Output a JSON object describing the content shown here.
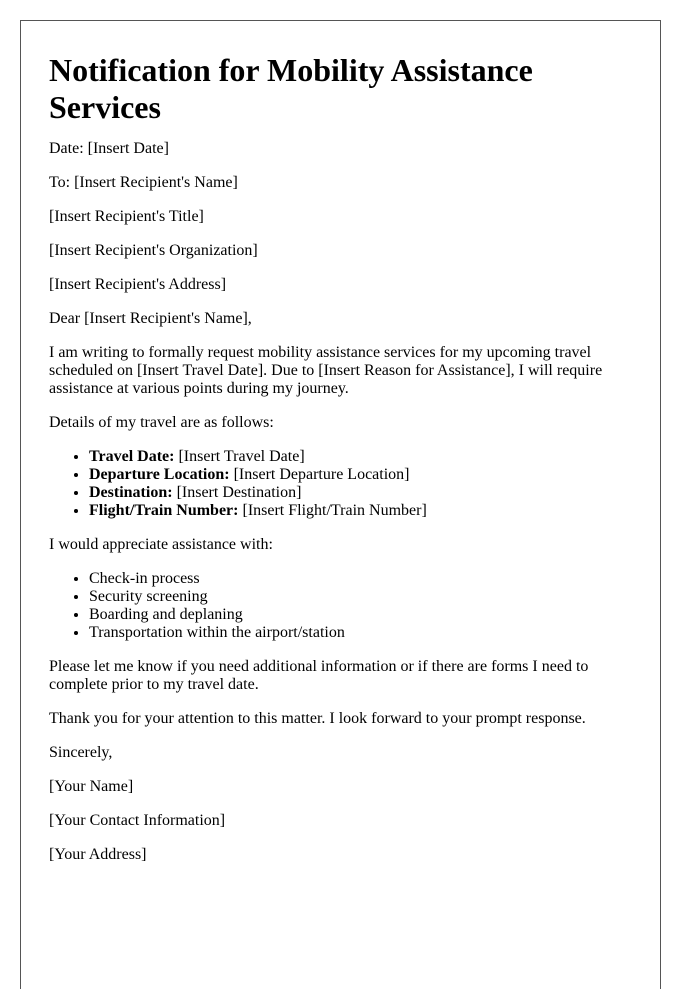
{
  "letter": {
    "title": "Notification for Mobility Assistance Services",
    "date_line": "Date: [Insert Date]",
    "to_line": "To: [Insert Recipient's Name]",
    "recipient_title": "[Insert Recipient's Title]",
    "recipient_org": "[Insert Recipient's Organization]",
    "recipient_address": "[Insert Recipient's Address]",
    "salutation": "Dear [Insert Recipient's Name],",
    "intro": "I am writing to formally request mobility assistance services for my upcoming travel scheduled on [Insert Travel Date]. Due to [Insert Reason for Assistance], I will require assistance at various points during my journey.",
    "details_heading": "Details of my travel are as follows:",
    "details": [
      {
        "label": "Travel Date:",
        "value": " [Insert Travel Date]"
      },
      {
        "label": "Departure Location:",
        "value": " [Insert Departure Location]"
      },
      {
        "label": "Destination:",
        "value": " [Insert Destination]"
      },
      {
        "label": "Flight/Train Number:",
        "value": " [Insert Flight/Train Number]"
      }
    ],
    "assistance_heading": "I would appreciate assistance with:",
    "assistance_items": [
      "Check-in process",
      "Security screening",
      "Boarding and deplaning",
      "Transportation within the airport/station"
    ],
    "followup": "Please let me know if you need additional information or if there are forms I need to complete prior to my travel date.",
    "thanks": "Thank you for your attention to this matter. I look forward to your prompt response.",
    "closing": "Sincerely,",
    "sender_name": "[Your Name]",
    "sender_contact": "[Your Contact Information]",
    "sender_address": "[Your Address]"
  }
}
